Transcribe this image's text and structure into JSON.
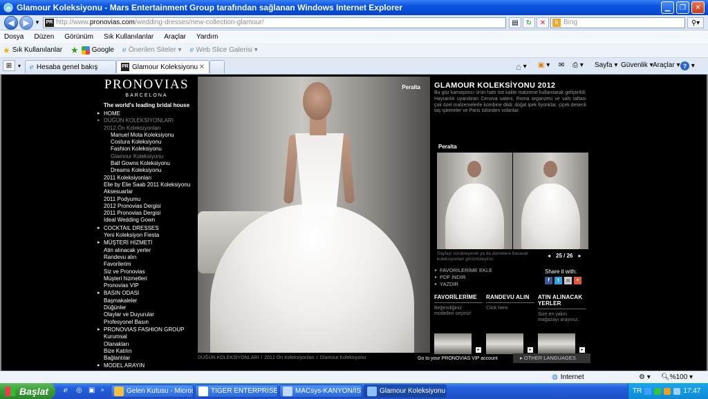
{
  "window": {
    "title": "Glamour Koleksiyonu - Mars Entertainment Group tarafından sağlanan Windows Internet Explorer"
  },
  "address": {
    "url_prefix": "http://www.",
    "url_domain": "pronovias.com",
    "url_path": "/wedding-dresses/new-collection-glamour/",
    "search_placeholder": "Bing",
    "favicon": "PR"
  },
  "menu": [
    "Dosya",
    "Düzen",
    "Görünüm",
    "Sık Kullanılanlar",
    "Araçlar",
    "Yardım"
  ],
  "favbar": {
    "favorites": "Sık Kullanılanlar",
    "google": "Google",
    "suggested": "Önerilen Siteler",
    "webslice": "Web Slice Galerisi"
  },
  "tabs": [
    {
      "label": "Hesaba genel bakış"
    },
    {
      "label": "Glamour Koleksiyonu",
      "favicon": "PR"
    }
  ],
  "commands": {
    "page": "Sayfa",
    "safety": "Güvenlik",
    "tools": "Araçlar"
  },
  "logo": {
    "brand": "PRONOVIAS",
    "city": "BARCELONA",
    "tagline": "The world's leading bridal house"
  },
  "nav": [
    {
      "label": "HOME",
      "type": "cat"
    },
    {
      "label": "DÜĞÜN KOLEKSİYONLARI",
      "type": "cat",
      "dim": true
    },
    {
      "label": "2012 Ön Koleksiyonları",
      "type": "l1",
      "dim": true
    },
    {
      "label": "Manuel Mota Koleksiyonu",
      "type": "l2"
    },
    {
      "label": "Costura Koleksiyonu",
      "type": "l2"
    },
    {
      "label": "Fashion Koleksiyonu",
      "type": "l2"
    },
    {
      "label": "Glamour Koleksiyonu",
      "type": "l2",
      "dim": true
    },
    {
      "label": "Ball Gowns Koleksiyonu",
      "type": "l2"
    },
    {
      "label": "Dreams Koleksiyonu",
      "type": "l2"
    },
    {
      "label": "2011 Koleksiyonları",
      "type": "l1"
    },
    {
      "label": "Elie by Elie Saab 2011 Koleksiyonu",
      "type": "l1"
    },
    {
      "label": "Aksesuarlar",
      "type": "l1"
    },
    {
      "label": "2011 Podyumu",
      "type": "l1"
    },
    {
      "label": "2012 Pronovias Dergisi",
      "type": "l1"
    },
    {
      "label": "2011 Pronovias Dergisi",
      "type": "l1"
    },
    {
      "label": "Ideal Wedding Gown",
      "type": "l1"
    },
    {
      "label": "COCKTAIL DRESSES",
      "type": "cat",
      "gap": true
    },
    {
      "label": "Yeni Koleksiyon Fiesta",
      "type": "l1"
    },
    {
      "label": "MÜŞTERİ HİZMETİ",
      "type": "cat",
      "gap": true
    },
    {
      "label": "Atin alınacak yerler",
      "type": "l1"
    },
    {
      "label": "Randevu alın",
      "type": "l1"
    },
    {
      "label": "Favorilerim",
      "type": "l1"
    },
    {
      "label": "Siz ve Pronovias",
      "type": "l1"
    },
    {
      "label": "Müşteri hizmetleri",
      "type": "l1"
    },
    {
      "label": "Pronovias VIP",
      "type": "l1"
    },
    {
      "label": "BASIN ODASI",
      "type": "cat",
      "gap": true
    },
    {
      "label": "Başmakaleler",
      "type": "l1"
    },
    {
      "label": "Düğünler",
      "type": "l1"
    },
    {
      "label": "Olaylar ve Duyurular",
      "type": "l1"
    },
    {
      "label": "Profesyonel Basın",
      "type": "l1"
    },
    {
      "label": "PRONOVIAS FASHION GROUP",
      "type": "cat",
      "gap": true
    },
    {
      "label": "Kurumsal",
      "type": "l1"
    },
    {
      "label": "Olanakları",
      "type": "l1"
    },
    {
      "label": "Bize Katılın",
      "type": "l1"
    },
    {
      "label": "Bağlantılar",
      "type": "l1"
    },
    {
      "label": "MODEL ARAYIN",
      "type": "cat",
      "gap": true
    }
  ],
  "photo": {
    "label": "Peralta"
  },
  "breadcrumb": [
    "DÜĞÜN KOLEKSİYONLARI",
    "/",
    "2012 Ön Koleksiyonları",
    "/",
    "Glamour Koleksiyonu"
  ],
  "content": {
    "title": "GLAMOUR KOLEKSİYONU 2012",
    "description": "Bu göz kamaştırıcı ürün hattı üst kalite malzeme kullanılarak geliştirildi. Hayranlık uyandıran Cenova sateni, Roma organzesi ve vals taftası çok özel malzemelerle kombine dildi: doğal ipek fiyonklar, çiçek desenli taş işlemeler ve Paris tülünden volanlar.",
    "thumb_label": "Peralta",
    "thumb_hint": "Sayfayı sürükleyerek ya da dümelere basarak koleksiyonları görüntüleyiniz.",
    "counter": "25 / 26",
    "actions": [
      "FAVORİLERİME EKLE",
      "PDF İNDİR",
      "YAZDIR"
    ],
    "share_label": "Share it with:",
    "columns": [
      {
        "heading": "FAVORİLERİME",
        "text": "Beğendiğiniz modelleri seçiniz!"
      },
      {
        "heading": "RANDEVU ALIN",
        "text": "Click here."
      },
      {
        "heading": "ATIN ALINACAK YERLER",
        "text": "Size en yakın mağazayı arayınız."
      }
    ],
    "vip": "Go to your PRONOVIAS VIP account",
    "other_languages": "OTHER LANGUAGES"
  },
  "status": {
    "zone": "Internet",
    "zoom": "%100"
  },
  "taskbar": {
    "start": "Başlat",
    "tasks": [
      "Gelen Kutusu - Micros...",
      "TIGER ENTERPRISE",
      "MACsys-KANYON/İST...",
      "Glamour Koleksiyonu ..."
    ],
    "lang": "TR",
    "time": "17:47"
  }
}
